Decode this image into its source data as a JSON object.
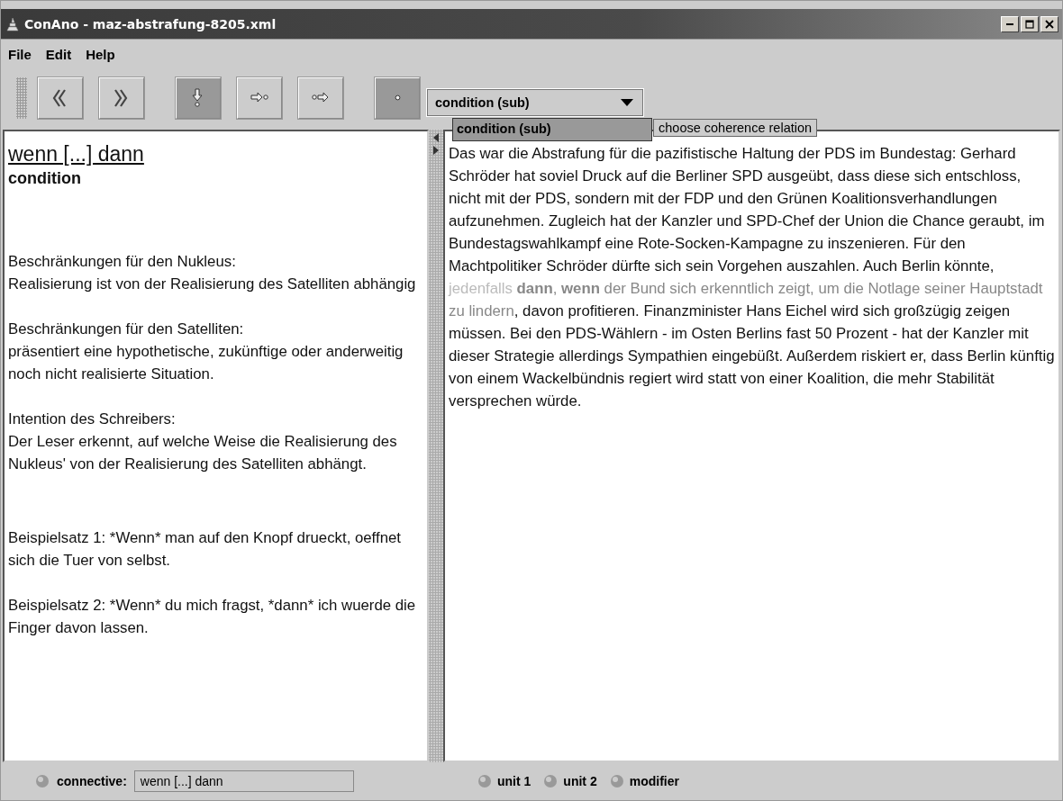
{
  "window": {
    "title": "ConAno - maz-abstrafung-8205.xml"
  },
  "menu": [
    "File",
    "Edit",
    "Help"
  ],
  "toolbar": [
    {
      "kind": "prev",
      "pressed": false
    },
    {
      "kind": "next",
      "pressed": false
    },
    {
      "kind": "down",
      "pressed": true
    },
    {
      "kind": "to-dot",
      "pressed": false
    },
    {
      "kind": "from-dot",
      "pressed": false
    },
    {
      "kind": "dot",
      "pressed": true
    }
  ],
  "relation": {
    "value": "condition (sub)",
    "options": [
      {
        "label": "condition (sub)",
        "selected": true
      }
    ],
    "tooltip": "choose coherence relation"
  },
  "info": {
    "connective": "wenn [...] dann",
    "relation": "condition",
    "sections": [
      {
        "heading": "Beschränkungen für den Nukleus:",
        "text": "Realisierung ist von der Realisierung des Satelliten abhängig"
      },
      {
        "heading": "Beschränkungen für den Satelliten:",
        "text": "präsentiert eine hypothetische, zukünftige oder anderweitig noch nicht realisierte Situation."
      },
      {
        "heading": "Intention des Schreibers:",
        "text": "Der Leser erkennt, auf welche Weise die Realisierung des Nukleus' von  der Realisierung des Satelliten abhängt."
      }
    ],
    "examples": [
      "Beispielsatz 1: *Wenn* man auf den Knopf drueckt, oeffnet sich die Tuer von selbst.",
      "Beispielsatz 2: *Wenn* du mich fragst, *dann* ich wuerde die Finger davon lassen."
    ]
  },
  "document": [
    {
      "kind": "text",
      "text": "Das war die Abstrafung für die pazifistische Haltung der PDS im Bundestag: Gerhard Schröder hat soviel Druck auf die Berliner SPD ausgeübt, dass diese sich entschloss, nicht mit der PDS, sondern mit der FDP und den Grünen Koalitionsverhandlungen aufzunehmen. Zugleich hat der Kanzler und SPD-Chef der Union die Chance geraubt, im Bundestagswahlkampf eine Rote-Socken-Kampagne zu inszenieren. Für den Machtpolitiker Schröder dürfte sich sein Vorgehen auszahlen. Auch Berlin könnte, "
    },
    {
      "kind": "modifier",
      "text": "jedenfalls "
    },
    {
      "kind": "connective",
      "text": "dann"
    },
    {
      "kind": "unit",
      "text": ", "
    },
    {
      "kind": "connective",
      "text": "wenn"
    },
    {
      "kind": "unit",
      "text": " der Bund sich erkenntlich zeigt, um die Notlage seiner Hauptstadt zu lindern"
    },
    {
      "kind": "text",
      "text": ", davon profitieren. Finanzminister Hans Eichel wird sich großzügig zeigen müssen. Bei den PDS-Wählern - im Osten Berlins fast 50 Prozent - hat der Kanzler mit dieser Strategie allerdings Sympathien eingebüßt. Außerdem riskiert er, dass Berlin künftig von einem Wackelbündnis regiert wird statt von einer Koalition, die mehr Stabilität versprechen würde."
    }
  ],
  "status_bar": {
    "connective_label": "connective:",
    "connective_value": "wenn [...] dann",
    "markers": [
      "unit 1",
      "unit 2",
      "modifier"
    ]
  }
}
